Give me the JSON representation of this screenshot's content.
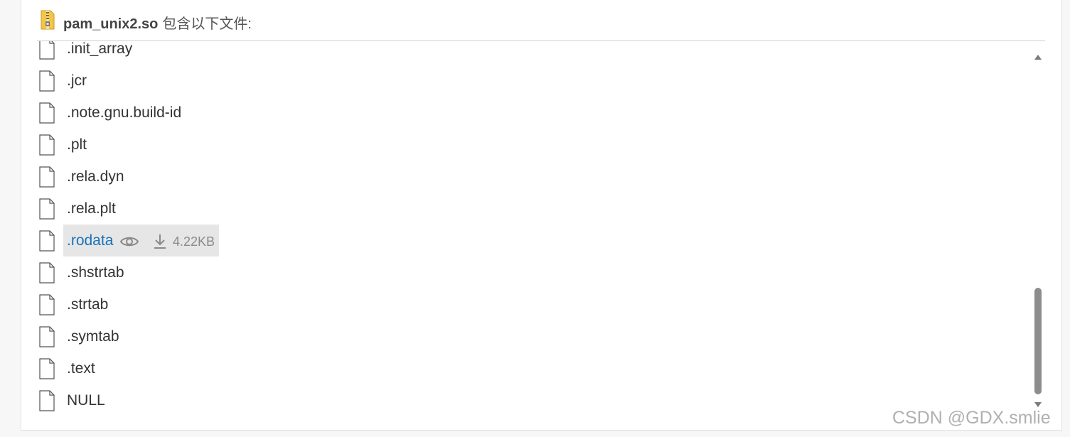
{
  "header": {
    "archive_name": "pam_unix2.so",
    "suffix_text": "包含以下文件:",
    "icon": "zip-archive-icon"
  },
  "files": [
    {
      "name": ".init_array",
      "icon": "file-icon"
    },
    {
      "name": ".jcr",
      "icon": "file-icon"
    },
    {
      "name": ".note.gnu.build-id",
      "icon": "file-icon"
    },
    {
      "name": ".plt",
      "icon": "file-icon"
    },
    {
      "name": ".rela.dyn",
      "icon": "file-icon"
    },
    {
      "name": ".rela.plt",
      "icon": "file-icon"
    },
    {
      "name": ".rodata",
      "icon": "file-icon",
      "size": "4.22KB",
      "actions": [
        "eye-icon",
        "download-icon"
      ]
    },
    {
      "name": ".shstrtab",
      "icon": "file-icon"
    },
    {
      "name": ".strtab",
      "icon": "file-icon"
    },
    {
      "name": ".symtab",
      "icon": "file-icon"
    },
    {
      "name": ".text",
      "icon": "file-icon"
    },
    {
      "name": "NULL",
      "icon": "file-icon"
    }
  ],
  "watermark": "CSDN @GDX.smlie",
  "colors": {
    "link": "#1a73b8",
    "highlight_bg": "#e6e6e6",
    "scrollbar_thumb": "#8d8d8d"
  }
}
